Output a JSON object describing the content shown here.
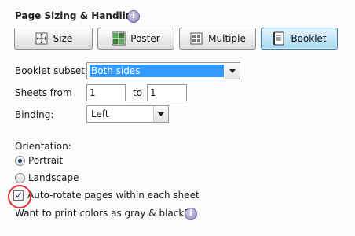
{
  "section": {
    "title": "Page Sizing & Handling",
    "info_glyph": "i"
  },
  "modes": {
    "size": "Size",
    "poster": "Poster",
    "multiple": "Multiple",
    "booklet": "Booklet",
    "active": "booklet"
  },
  "booklet_subset": {
    "label": "Booklet subset:",
    "value": "Both sides"
  },
  "sheets": {
    "label": "Sheets from",
    "from": "1",
    "to_label": "to",
    "to": "1"
  },
  "binding": {
    "label": "Binding:",
    "value": "Left"
  },
  "orientation": {
    "label": "Orientation:",
    "portrait": "Portrait",
    "landscape": "Landscape",
    "selected": "portrait"
  },
  "auto_rotate": {
    "label": "Auto-rotate pages within each sheet",
    "checked": true
  },
  "gray_print": {
    "label": "Want to print colors as gray & black?",
    "info_glyph": "i"
  },
  "colors": {
    "active_button": "#a9daf3",
    "highlight": "#3399ff",
    "annotation": "#e0303a"
  }
}
